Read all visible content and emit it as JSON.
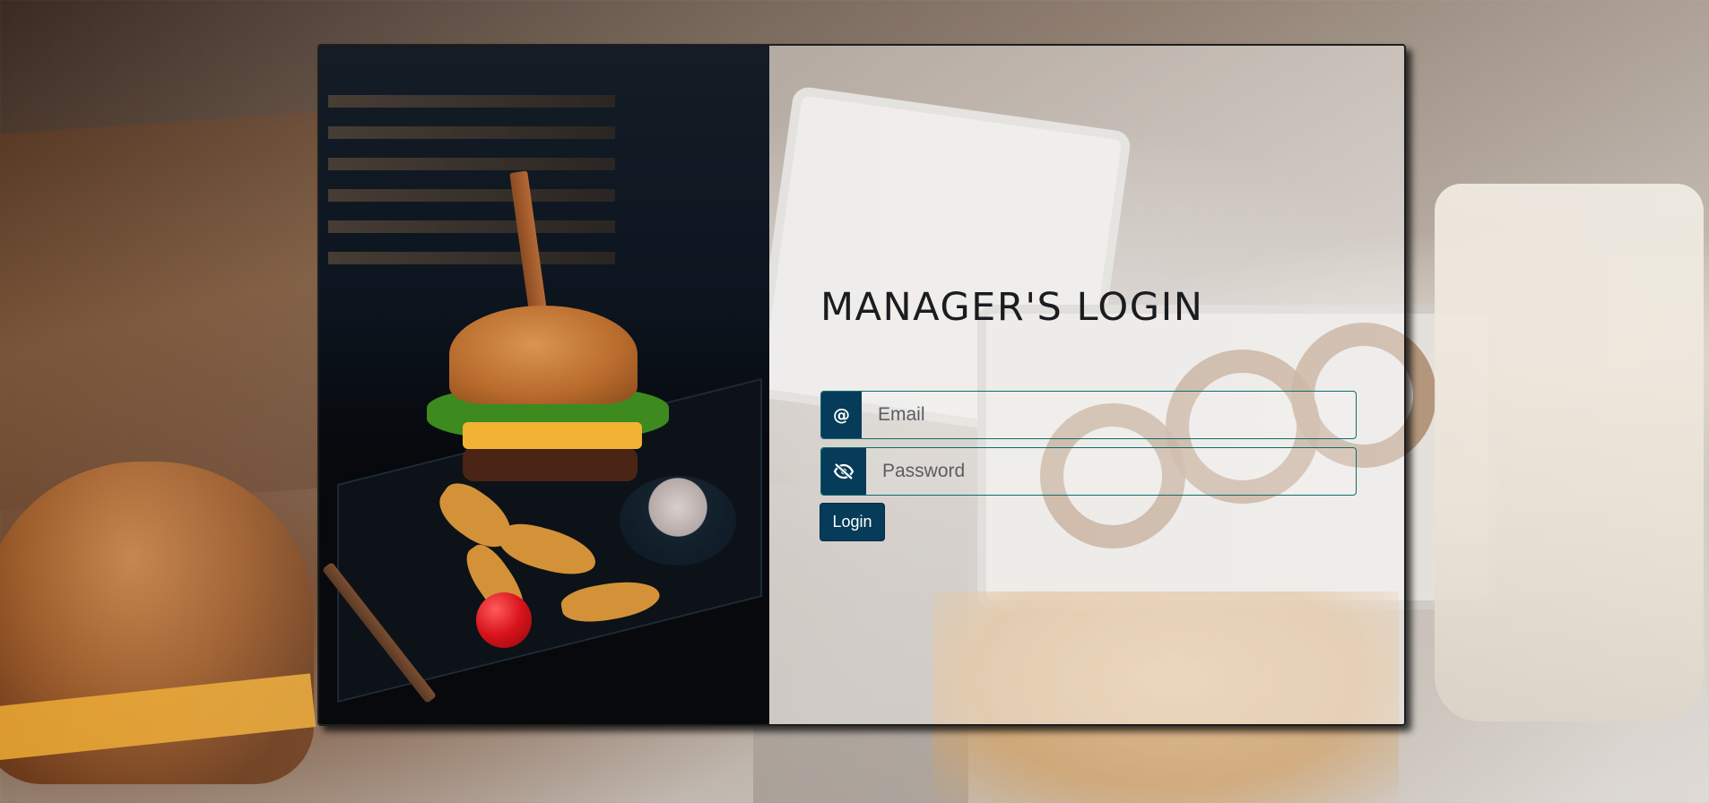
{
  "page": {
    "title": "MANAGER'S LOGIN"
  },
  "form": {
    "email": {
      "icon": "at-sign-icon",
      "icon_glyph": "@",
      "placeholder": "Email",
      "value": ""
    },
    "password": {
      "icon": "eye-slash-icon",
      "placeholder": "Password",
      "value": ""
    },
    "submit_label": "Login"
  },
  "colors": {
    "primary": "#063b5a",
    "input_border": "#0c6e6a",
    "title_text": "#1a1c1f"
  }
}
